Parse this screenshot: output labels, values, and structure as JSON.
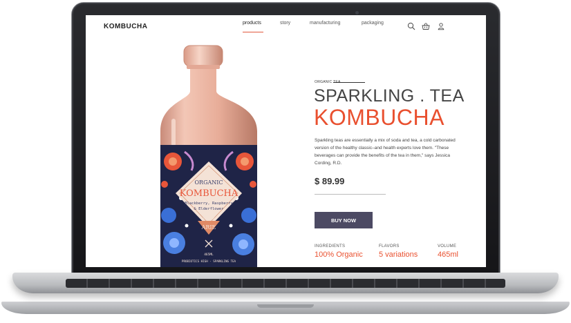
{
  "brand": "KOMBUCHA",
  "nav": {
    "items": [
      {
        "label": "products",
        "active": true
      },
      {
        "label": "story",
        "active": false
      },
      {
        "label": "manufacturing",
        "active": false
      },
      {
        "label": "packaging",
        "active": false
      }
    ],
    "icons": [
      "search-icon",
      "basket-icon",
      "user-icon"
    ],
    "accent": "#e2573c"
  },
  "hero": {
    "eyebrow": "ORGANIC TEA",
    "title_line1": "SPARKLING . TEA",
    "title_line2": "KOMBUCHA",
    "description": "Sparkling teas are essentially a mix of soda and tea, a cold carbonated version of the healthy classic–and health experts love them. \"These beverages can provide the benefits of the tea in them,\" says Jessica Cording, R.D.",
    "price": "$ 89.99",
    "buy_label": "BUY NOW",
    "buy_color": "#4c4a63",
    "accent": "#e9502f"
  },
  "specs": [
    {
      "label": "INGREDIENTS",
      "value": "100% Organic"
    },
    {
      "label": "FLAVORS",
      "value": "5 variations"
    },
    {
      "label": "VOLUME",
      "value": "465ml"
    }
  ],
  "bottle_label": {
    "top": "ORGANIC",
    "name": "KOMBUCHA",
    "flavor_line1": "Blackberry, Raspberry",
    "flavor_line2": "& Elderflower",
    "small": "LOVE AT LIFE",
    "maker": "ARIE",
    "volume": "465ML",
    "footer": "PROBIOTICS HIGH · SPARKLING TEA"
  }
}
